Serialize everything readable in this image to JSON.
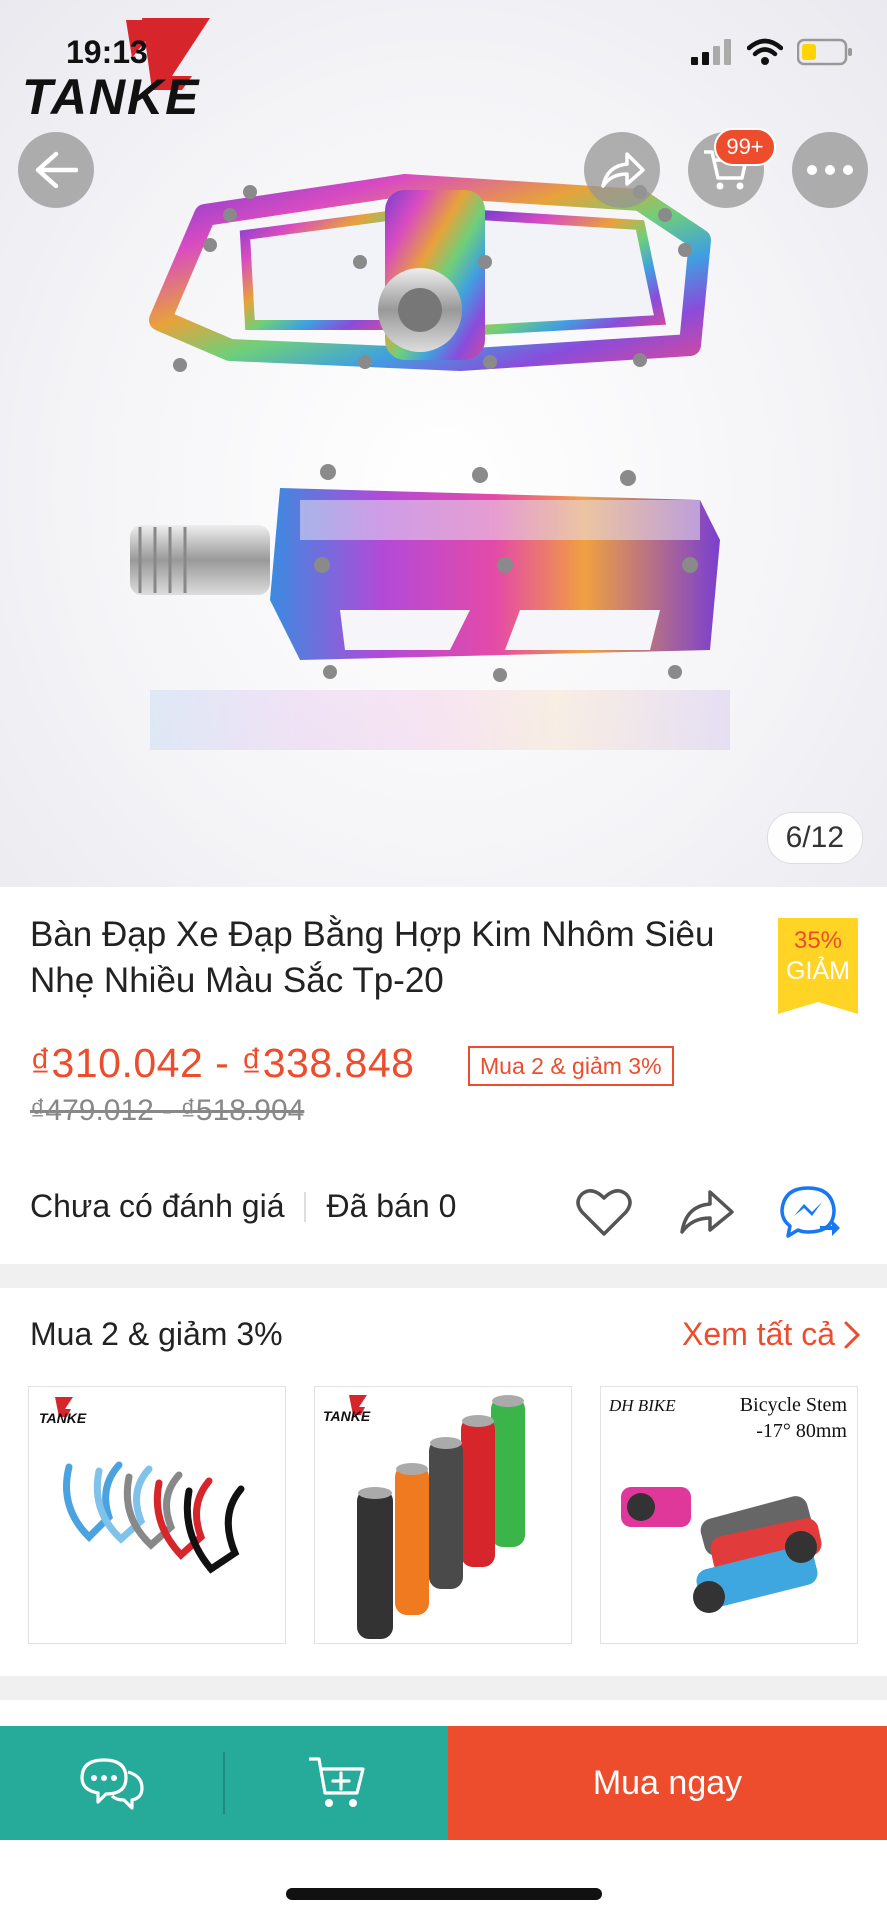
{
  "status_bar": {
    "time": "19:13"
  },
  "brand": {
    "logo_text": "TANKE"
  },
  "header": {
    "cart_badge": "99+"
  },
  "gallery": {
    "counter": "6/12"
  },
  "product": {
    "title": "Bàn Đạp Xe Đạp Bằng Hợp Kim Nhôm Siêu Nhẹ Nhiều Màu Sắc Tp-20",
    "discount_percent": "35%",
    "discount_word": "GIẢM",
    "price_range": "₫310.042 - ₫338.848",
    "promo_chip": "Mua 2 & giảm 3%",
    "original_price_range": "₫479.012 - ₫518.904",
    "rating_text": "Chưa có đánh giá",
    "sold_text": "Đã bán 0"
  },
  "combo": {
    "title": "Mua 2 & giảm 3%",
    "see_all": "Xem tất cả",
    "items": [
      {
        "brand": "TANKE"
      },
      {
        "brand": "TANKE"
      },
      {
        "brand": "DH BIKE",
        "caption_line1": "Bicycle Stem",
        "caption_line2": "-17° 80mm"
      }
    ]
  },
  "bottom_bar": {
    "buy_now": "Mua ngay"
  },
  "colors": {
    "accent": "#ee4d2d",
    "teal": "#26aa99",
    "badge_yellow": "#ffd424",
    "link_blue": "#1877f2"
  },
  "icons": [
    "back-arrow-icon",
    "share-icon",
    "cart-icon",
    "more-icon",
    "heart-icon",
    "messenger-icon",
    "chat-icon",
    "add-to-cart-icon",
    "chevron-right-icon"
  ]
}
